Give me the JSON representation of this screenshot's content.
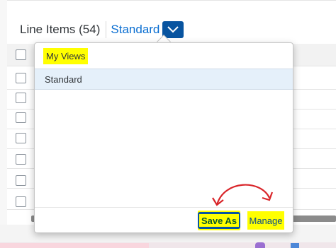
{
  "header": {
    "title": "Line Items (54)",
    "view_selector": "Standard",
    "dropdown_icon": "chevron-down-icon"
  },
  "popover": {
    "section_title": "My Views",
    "items": [
      {
        "label": "Standard",
        "selected": true
      }
    ],
    "footer": {
      "save_as_label": "Save As",
      "manage_label": "Manage"
    }
  },
  "table": {
    "row_count_visible": 7
  },
  "colors": {
    "accent": "#0854a0",
    "link": "#0a6ed1",
    "highlight": "#ffff00",
    "annotation_arrow": "#d9252a",
    "selected_row": "#e5f0fa"
  }
}
